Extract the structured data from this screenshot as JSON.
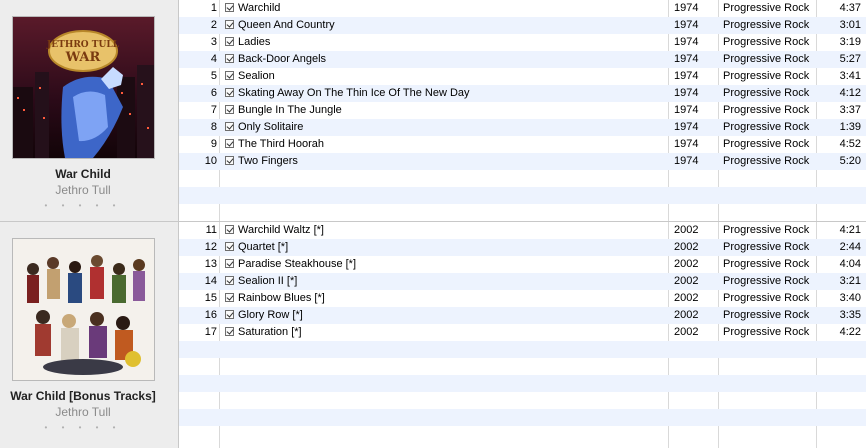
{
  "albums": [
    {
      "title": "War Child",
      "artist": "Jethro Tull",
      "rating_stars": "• • • • •",
      "art_text": "JETHRO TULL WAR CHILD",
      "tracks": [
        {
          "num": "1",
          "name": "Warchild",
          "year": "1974",
          "genre": "Progressive Rock",
          "time": "4:37"
        },
        {
          "num": "2",
          "name": "Queen And Country",
          "year": "1974",
          "genre": "Progressive Rock",
          "time": "3:01"
        },
        {
          "num": "3",
          "name": "Ladies",
          "year": "1974",
          "genre": "Progressive Rock",
          "time": "3:19"
        },
        {
          "num": "4",
          "name": "Back-Door Angels",
          "year": "1974",
          "genre": "Progressive Rock",
          "time": "5:27"
        },
        {
          "num": "5",
          "name": "Sealion",
          "year": "1974",
          "genre": "Progressive Rock",
          "time": "3:41"
        },
        {
          "num": "6",
          "name": "Skating Away On The Thin Ice Of The New Day",
          "year": "1974",
          "genre": "Progressive Rock",
          "time": "4:12"
        },
        {
          "num": "7",
          "name": "Bungle In The Jungle",
          "year": "1974",
          "genre": "Progressive Rock",
          "time": "3:37"
        },
        {
          "num": "8",
          "name": "Only Solitaire",
          "year": "1974",
          "genre": "Progressive Rock",
          "time": "1:39"
        },
        {
          "num": "9",
          "name": "The Third Hoorah",
          "year": "1974",
          "genre": "Progressive Rock",
          "time": "4:52"
        },
        {
          "num": "10",
          "name": "Two Fingers",
          "year": "1974",
          "genre": "Progressive Rock",
          "time": "5:20"
        }
      ]
    },
    {
      "title": "War Child [Bonus Tracks]",
      "artist": "Jethro Tull",
      "rating_stars": "• • • • •",
      "tracks": [
        {
          "num": "11",
          "name": "Warchild Waltz [*]",
          "year": "2002",
          "genre": "Progressive Rock",
          "time": "4:21"
        },
        {
          "num": "12",
          "name": "Quartet [*]",
          "year": "2002",
          "genre": "Progressive Rock",
          "time": "2:44"
        },
        {
          "num": "13",
          "name": "Paradise Steakhouse [*]",
          "year": "2002",
          "genre": "Progressive Rock",
          "time": "4:04"
        },
        {
          "num": "14",
          "name": "Sealion II [*]",
          "year": "2002",
          "genre": "Progressive Rock",
          "time": "3:21"
        },
        {
          "num": "15",
          "name": "Rainbow Blues [*]",
          "year": "2002",
          "genre": "Progressive Rock",
          "time": "3:40"
        },
        {
          "num": "16",
          "name": "Glory Row [*]",
          "year": "2002",
          "genre": "Progressive Rock",
          "time": "3:35"
        },
        {
          "num": "17",
          "name": "Saturation [*]",
          "year": "2002",
          "genre": "Progressive Rock",
          "time": "4:22"
        }
      ]
    }
  ],
  "colors": {
    "alt_row": "#edf3fe",
    "art_column": "#ededed",
    "divider": "#d9d9d9"
  }
}
